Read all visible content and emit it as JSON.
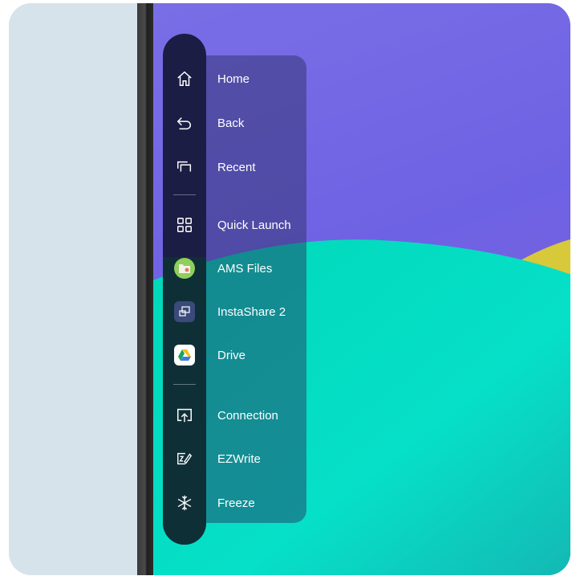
{
  "menu": {
    "items": [
      {
        "label": "Home",
        "icon": "home-icon"
      },
      {
        "label": "Back",
        "icon": "back-arrow-icon"
      },
      {
        "label": "Recent",
        "icon": "recent-windows-icon"
      },
      {
        "label": "Quick Launch",
        "icon": "grid-apps-icon"
      },
      {
        "label": "AMS Files",
        "icon": "ams-files-app-icon"
      },
      {
        "label": "InstaShare 2",
        "icon": "instashare-app-icon"
      },
      {
        "label": "Drive",
        "icon": "google-drive-app-icon"
      },
      {
        "label": "Connection",
        "icon": "cast-upload-icon"
      },
      {
        "label": "EZWrite",
        "icon": "ezwrite-pen-icon"
      },
      {
        "label": "Freeze",
        "icon": "snowflake-icon"
      }
    ]
  },
  "colors": {
    "toolbar": "#1b1d44",
    "wallpaper_purple": "#6e62e4",
    "wallpaper_teal": "#06dcc0",
    "wallpaper_yellow": "#d8c93a",
    "left_panel": "#d7e3ea"
  }
}
